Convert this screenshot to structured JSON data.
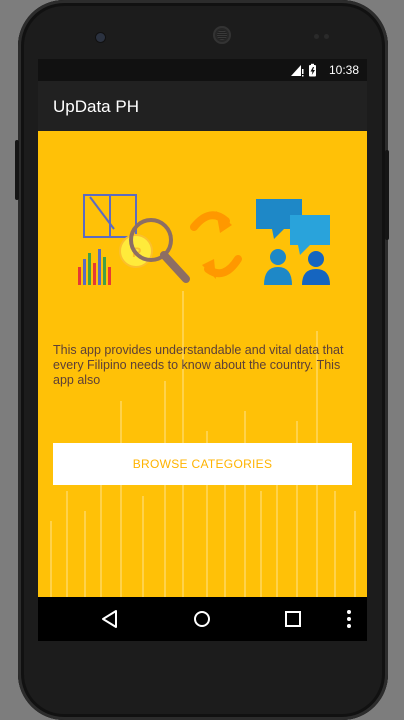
{
  "status_bar": {
    "time": "10:38",
    "icons": [
      "signal-icon",
      "battery-icon"
    ]
  },
  "app_bar": {
    "title": "UpData PH"
  },
  "main": {
    "description": "This app provides understandable and vital data that every Filipino needs to know about the country. This app also",
    "browse_button_label": "BROWSE CATEGORIES"
  },
  "navigation_bar": {
    "buttons": [
      "back-icon",
      "home-icon",
      "recents-icon",
      "overflow-menu-icon"
    ]
  },
  "colors": {
    "background": "#ffc107",
    "app_bar": "#212121",
    "button_text": "#ffb300",
    "description_text": "#5d4037",
    "hero_blue": "#1e88c7",
    "hero_orange": "#ff9800"
  }
}
